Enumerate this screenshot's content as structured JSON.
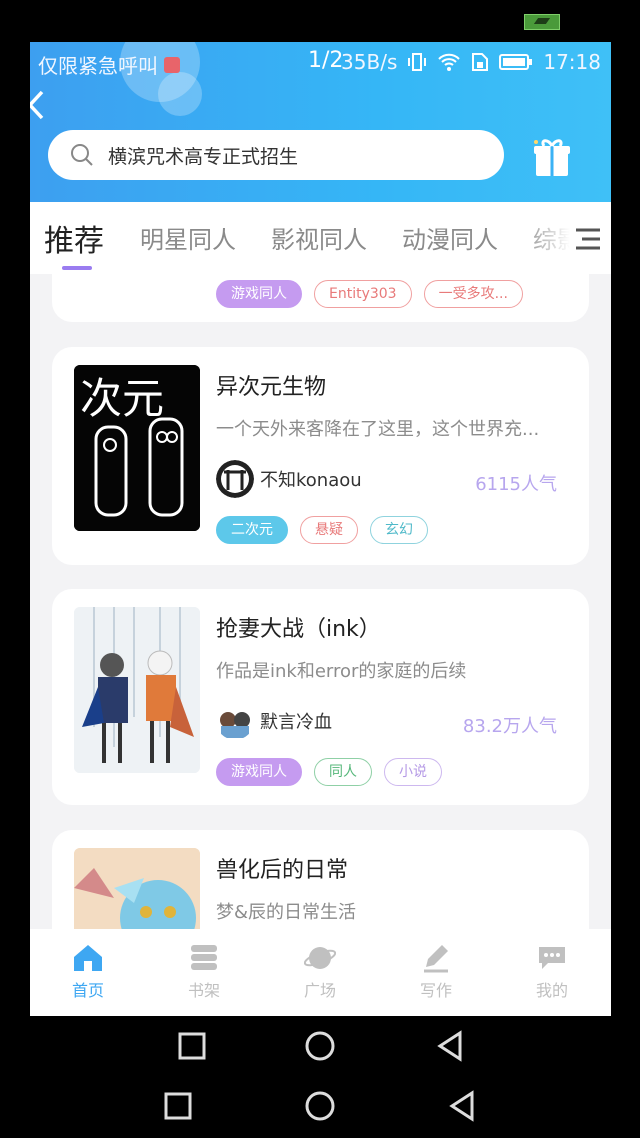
{
  "status_bar": {
    "carrier": "仅限紧急呼叫",
    "speed": "35B/s",
    "time": "17:18"
  },
  "page_indicator": "1/2",
  "search": {
    "placeholder": "横滨咒术高专正式招生"
  },
  "tabs": [
    {
      "label": "推荐",
      "active": true
    },
    {
      "label": "明星同人"
    },
    {
      "label": "影视同人"
    },
    {
      "label": "动漫同人"
    },
    {
      "label": "综影"
    }
  ],
  "cards": [
    {
      "tags": [
        "游戏同人",
        "Entity303",
        "一受多攻..."
      ]
    },
    {
      "title": "异次元生物",
      "desc": "一个天外来客降在了这里，这个世界充...",
      "author": "不知konaou",
      "popularity": "6115人气",
      "cover_text": "次元",
      "tags": [
        "二次元",
        "悬疑",
        "玄幻"
      ]
    },
    {
      "title": "抢妻大战（ink）",
      "desc": "作品是ink和error的家庭的后续",
      "author": "默言冷血",
      "popularity": "83.2万人气",
      "tags": [
        "游戏同人",
        "同人",
        "小说"
      ]
    },
    {
      "title": "兽化后的日常",
      "desc": "梦&辰的日常生活"
    }
  ],
  "bottom_nav": [
    {
      "label": "首页",
      "icon": "home-icon",
      "active": true
    },
    {
      "label": "书架",
      "icon": "bookshelf-icon"
    },
    {
      "label": "广场",
      "icon": "planet-icon"
    },
    {
      "label": "写作",
      "icon": "pen-icon"
    },
    {
      "label": "我的",
      "icon": "chat-icon"
    }
  ],
  "colors": {
    "header": "#35b6f6",
    "accent": "#3ea7f2",
    "tab_underline": "#9a7cf0",
    "popularity": "#b7a6ee"
  }
}
